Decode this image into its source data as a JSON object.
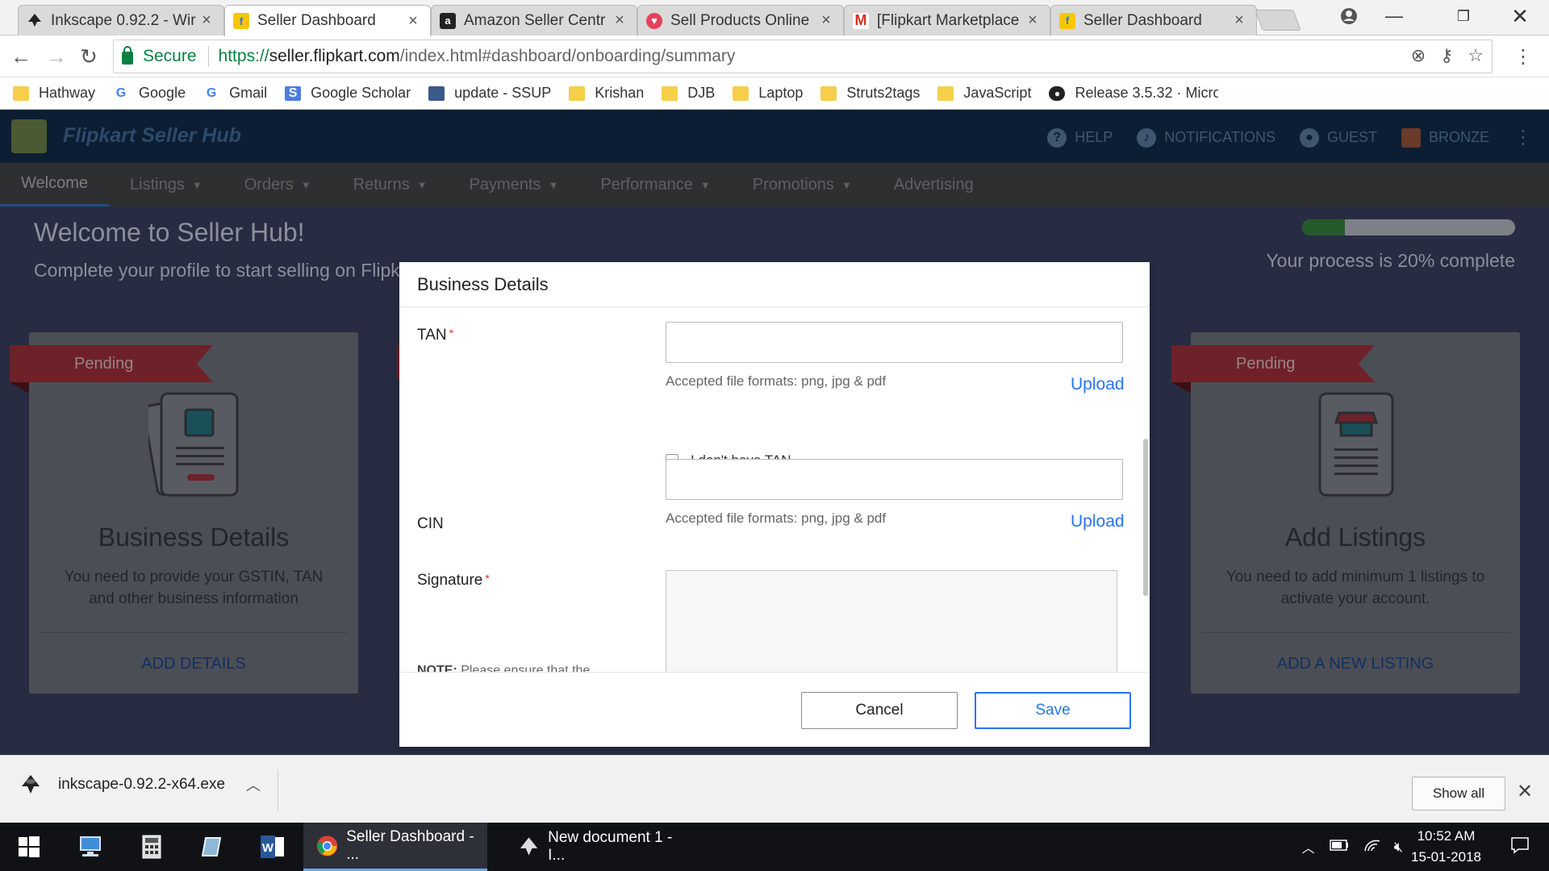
{
  "browser": {
    "tabs": [
      {
        "title": "Inkscape 0.92.2 - Wir",
        "icon": "inkscape-icon",
        "active": false
      },
      {
        "title": "Seller Dashboard",
        "icon": "flipkart-icon",
        "active": true
      },
      {
        "title": "Amazon Seller Centr",
        "icon": "amazon-icon",
        "active": false
      },
      {
        "title": "Sell Products Online",
        "icon": "paytm-icon",
        "active": false
      },
      {
        "title": "[Flipkart Marketplace",
        "icon": "gmail-icon",
        "active": false
      },
      {
        "title": "Seller Dashboard",
        "icon": "flipkart-icon",
        "active": false
      }
    ],
    "secure_label": "Secure",
    "url_scheme": "https://",
    "url_host": "seller.flipkart.com",
    "url_rest": "/index.html#dashboard/onboarding/summary",
    "bookmarks": [
      {
        "label": "Hathway",
        "icon": "folder-icon"
      },
      {
        "label": "Google",
        "icon": "google-icon"
      },
      {
        "label": "Gmail",
        "icon": "google-icon"
      },
      {
        "label": "Google Scholar",
        "icon": "scholar-icon"
      },
      {
        "label": "update - SSUP",
        "icon": "page-icon"
      },
      {
        "label": "Krishan",
        "icon": "folder-icon"
      },
      {
        "label": "DJB",
        "icon": "folder-icon"
      },
      {
        "label": "Laptop",
        "icon": "folder-icon"
      },
      {
        "label": "Struts2tags",
        "icon": "folder-icon"
      },
      {
        "label": "JavaScript",
        "icon": "folder-icon"
      },
      {
        "label": "Release 3.5.32 · Micro",
        "icon": "github-icon"
      }
    ]
  },
  "hub": {
    "brand": "Flipkart Seller Hub",
    "actions": {
      "help": "HELP",
      "notifications": "NOTIFICATIONS",
      "guest": "GUEST",
      "tier": "BRONZE"
    },
    "nav": [
      "Welcome",
      "Listings",
      "Orders",
      "Returns",
      "Payments",
      "Performance",
      "Promotions",
      "Advertising"
    ],
    "welcome_title": "Welcome to Seller Hub!",
    "welcome_subtitle": "Complete your profile to start selling on Flipkart",
    "progress_fraction": 0.2,
    "progress_text": "Your process is 20% complete",
    "cards": {
      "business": {
        "status": "Pending",
        "title": "Business Details",
        "description": "You need to provide your GSTIN, TAN and other business information",
        "cta": "ADD DETAILS"
      },
      "listings": {
        "status": "Pending",
        "title": "Add Listings",
        "description": "You need to add minimum 1 listings to activate your account.",
        "cta": "ADD A NEW LISTING"
      }
    }
  },
  "modal": {
    "title": "Business Details",
    "tan_label": "TAN",
    "tan_value": "",
    "formats_text": "Accepted file formats: png, jpg & pdf",
    "upload_label": "Upload",
    "no_tan_label": "I don't have TAN",
    "no_tan_checked": false,
    "cin_label": "CIN",
    "cin_value": "",
    "signature_label": "Signature",
    "note_prefix": "NOTE:",
    "note_text": "Please ensure that the image of the signature is of an authorised signatory (as",
    "cancel_label": "Cancel",
    "save_label": "Save"
  },
  "downloads": {
    "file": "inkscape-0.92.2-x64.exe",
    "show_all": "Show all"
  },
  "taskbar": {
    "apps": [
      {
        "label": "Seller Dashboard - ...",
        "icon": "chrome-icon",
        "active": true
      },
      {
        "label": "New document 1 - I...",
        "icon": "inkscape-icon",
        "active": false
      }
    ],
    "time": "10:52 AM",
    "date": "15-01-2018"
  },
  "colors": {
    "accent_blue": "#2874f0",
    "required_red": "#e02b2b",
    "secure_green": "#0b8043"
  }
}
